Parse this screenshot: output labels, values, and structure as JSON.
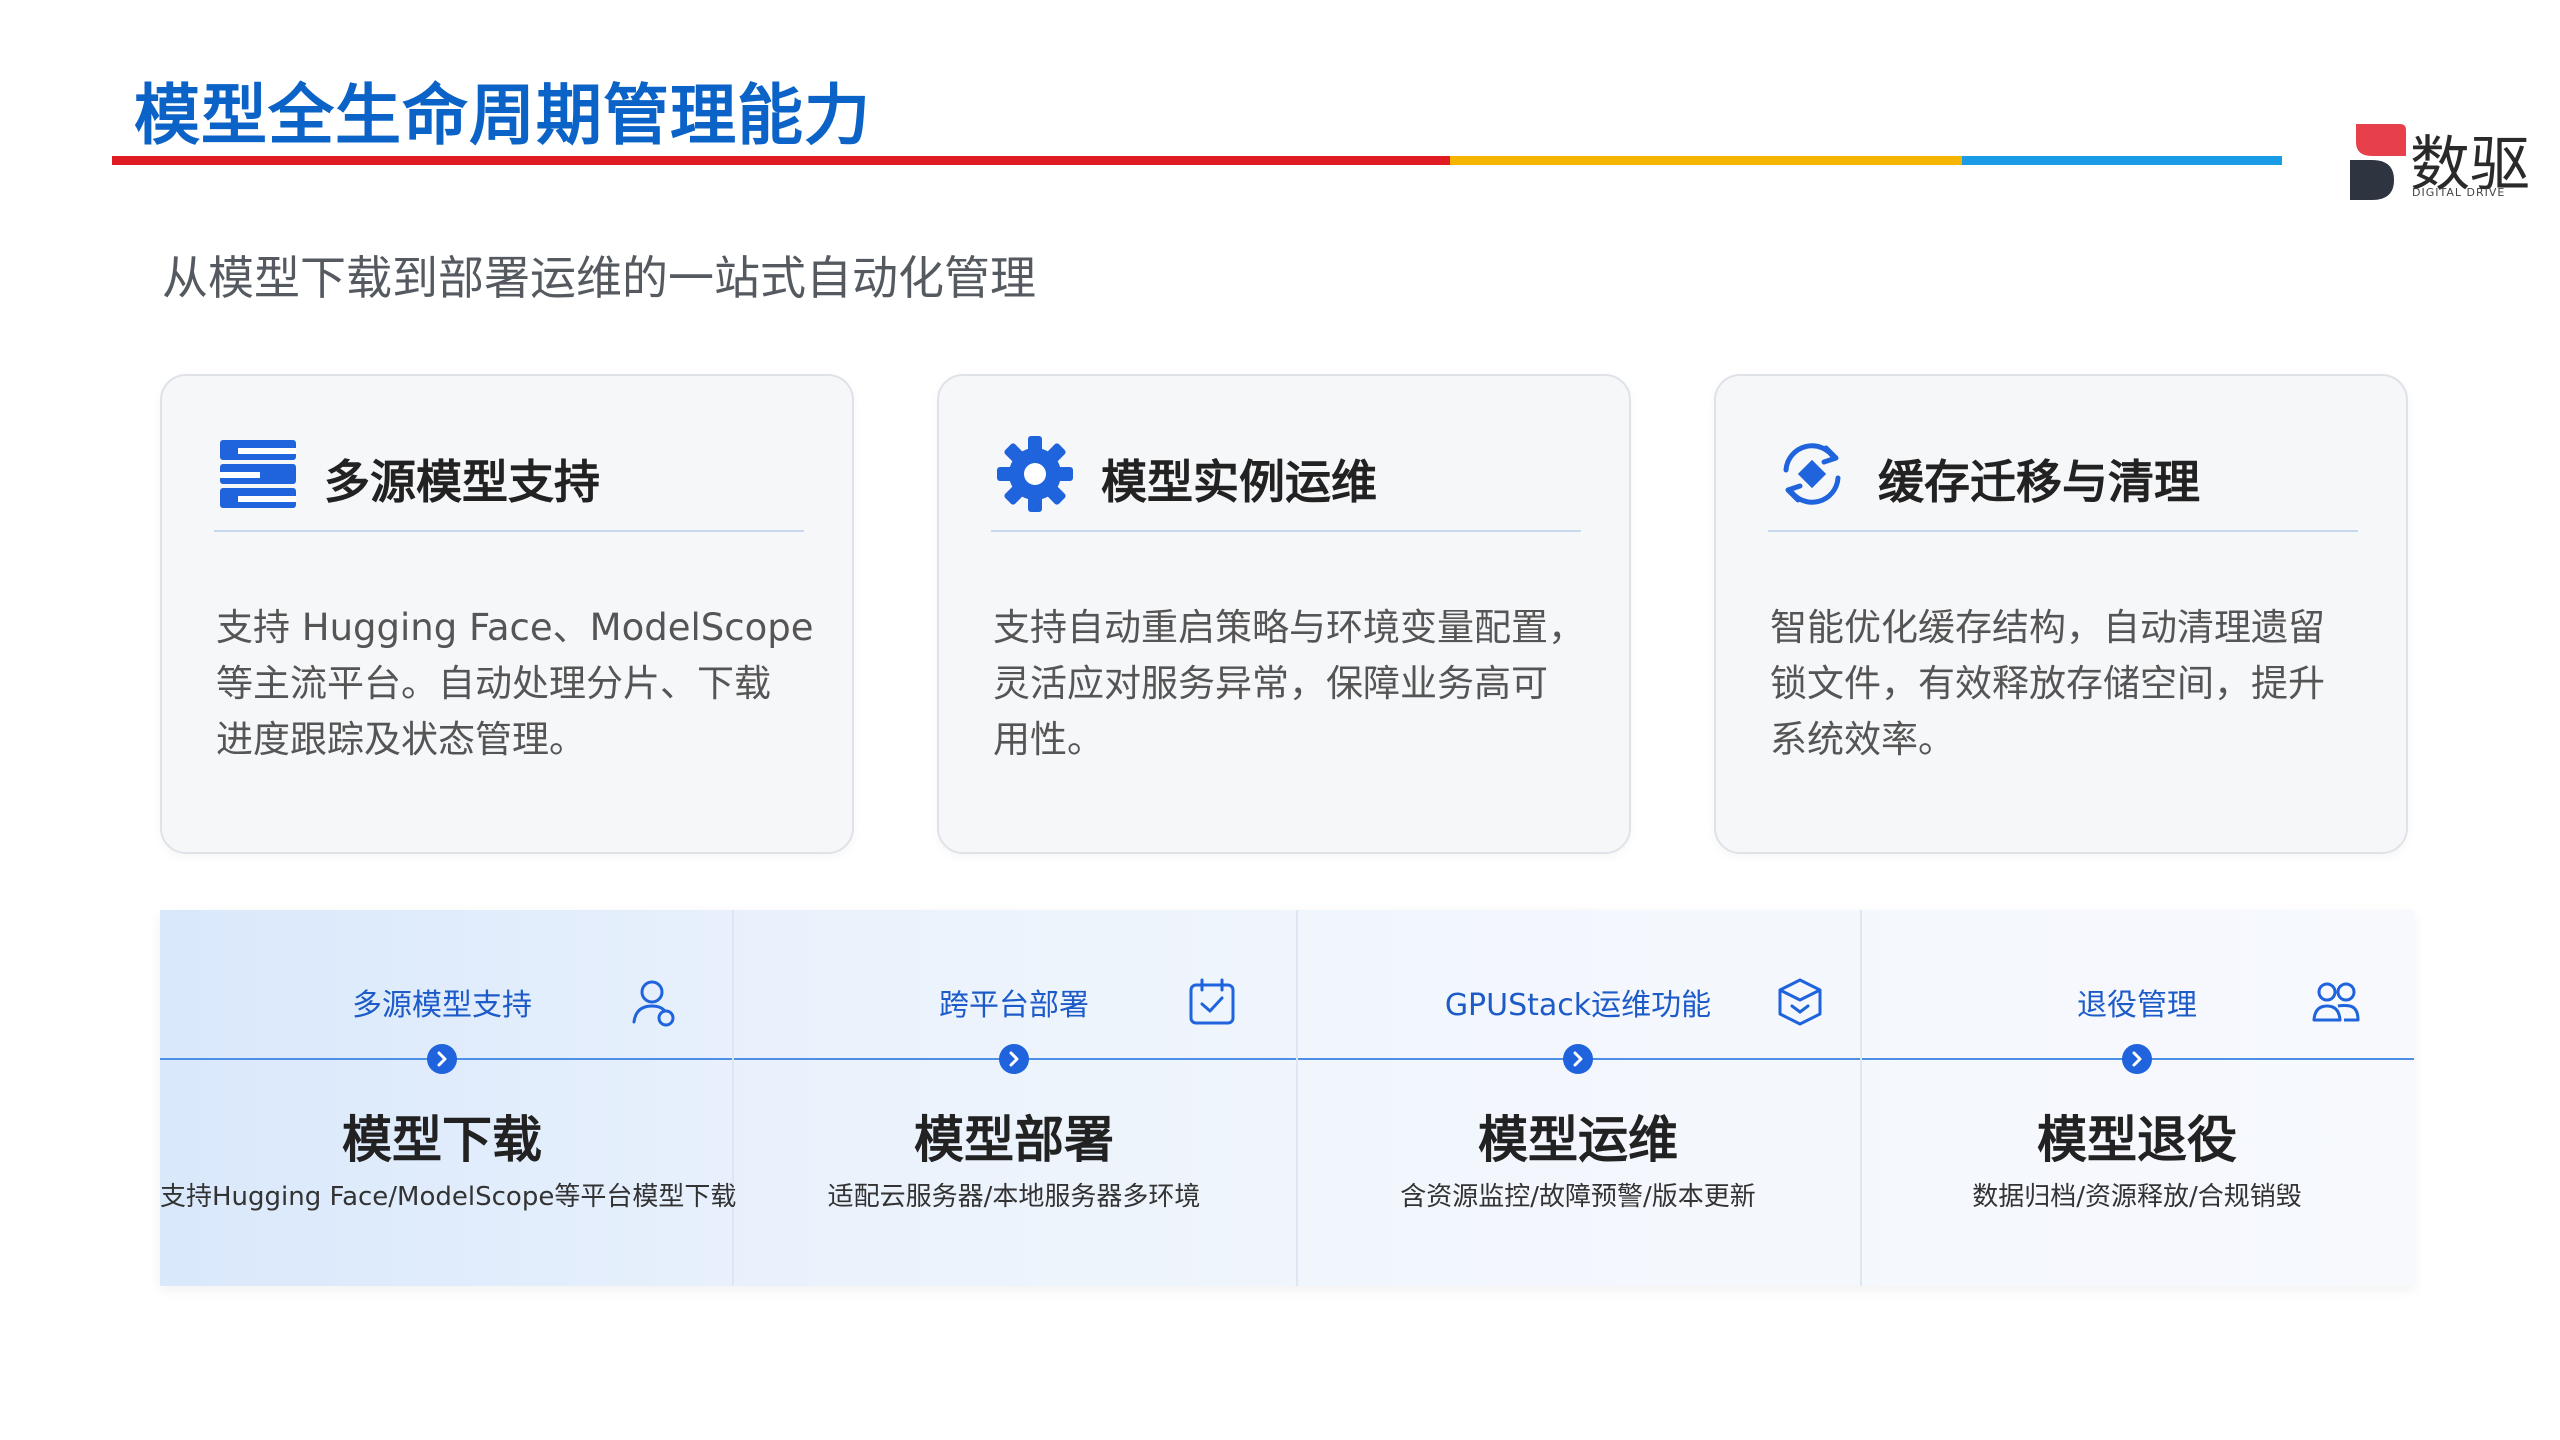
{
  "header": {
    "title": "模型全生命周期管理能力",
    "logo": {
      "name": "数驱",
      "sub": "DIGITAL DRIVE",
      "icon": "brand-logo-icon"
    }
  },
  "subtitle": "从模型下载到部署运维的一站式自动化管理",
  "colors": {
    "title": "#0b63c7",
    "bar_red": "#e01b24",
    "bar_yellow": "#f5b400",
    "bar_blue": "#1a9be6",
    "accent": "#1f63dd"
  },
  "cards": [
    {
      "icon": "server-stack-icon",
      "title": "多源模型支持",
      "desc": [
        "支持 Hugging Face、ModelScope",
        "等主流平台。自动处理分片、下载",
        "进度跟踪及状态管理。"
      ]
    },
    {
      "icon": "gear-icon",
      "title": "模型实例运维",
      "desc": [
        "支持自动重启策略与环境变量配置，",
        "灵活应对服务异常，保障业务高可",
        "用性。"
      ]
    },
    {
      "icon": "refresh-cycle-icon",
      "title": "缓存迁移与清理",
      "desc": [
        "智能优化缓存结构，自动清理遗留",
        "锁文件，有效释放存储空间，提升",
        "系统效率。"
      ]
    }
  ],
  "stages": [
    {
      "label": "多源模型支持",
      "icon": "user-icon",
      "name": "模型下载",
      "desc": "支持Hugging Face/ModelScope等平台模型下载"
    },
    {
      "label": "跨平台部署",
      "icon": "calendar-check-icon",
      "name": "模型部署",
      "desc": "适配云服务器/本地服务器多环境"
    },
    {
      "label": "GPUStack运维功能",
      "icon": "cube-icon",
      "name": "模型运维",
      "desc": "含资源监控/故障预警/版本更新"
    },
    {
      "label": "退役管理",
      "icon": "users-icon",
      "name": "模型退役",
      "desc": "数据归档/资源释放/合规销毁"
    }
  ]
}
